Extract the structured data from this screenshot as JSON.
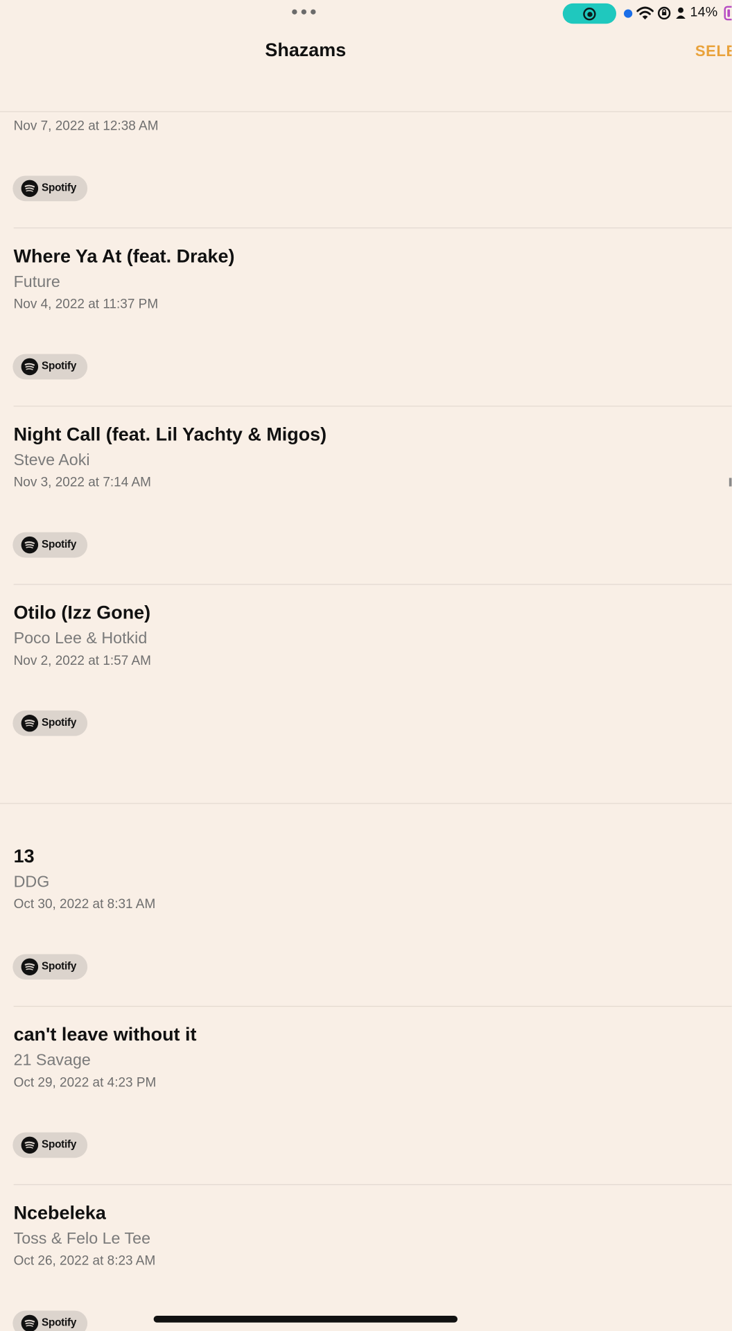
{
  "status_bar": {
    "battery_percent": "14%",
    "record_color": "#1fc8be",
    "battery_color": "#b64bc3"
  },
  "nav": {
    "title": "Shazams",
    "select_label": "SELE",
    "accent_color": "#e9a23b"
  },
  "songs": [
    {
      "title": "",
      "artist": "",
      "date": "Nov 7, 2022 at 12:38 AM",
      "service": "Spotify"
    },
    {
      "title": "Where Ya At (feat. Drake)",
      "artist": "Future",
      "date": "Nov 4, 2022 at 11:37 PM",
      "service": "Spotify"
    },
    {
      "title": "Night Call (feat. Lil Yachty & Migos)",
      "artist": "Steve Aoki",
      "date": "Nov 3, 2022 at 7:14 AM",
      "service": "Spotify"
    },
    {
      "title": "Otilo (Izz Gone)",
      "artist": "Poco Lee & Hotkid",
      "date": "Nov 2, 2022 at 1:57 AM",
      "service": "Spotify"
    },
    {
      "title": "13",
      "artist": "DDG",
      "date": "Oct 30, 2022 at 8:31 AM",
      "service": "Spotify"
    },
    {
      "title": "can't leave without it",
      "artist": "21 Savage",
      "date": "Oct 29, 2022 at 4:23 PM",
      "service": "Spotify"
    },
    {
      "title": "Ncebeleka",
      "artist": "Toss & Felo Le Tee",
      "date": "Oct 26, 2022 at 8:23 AM",
      "service": "Spotify"
    }
  ]
}
